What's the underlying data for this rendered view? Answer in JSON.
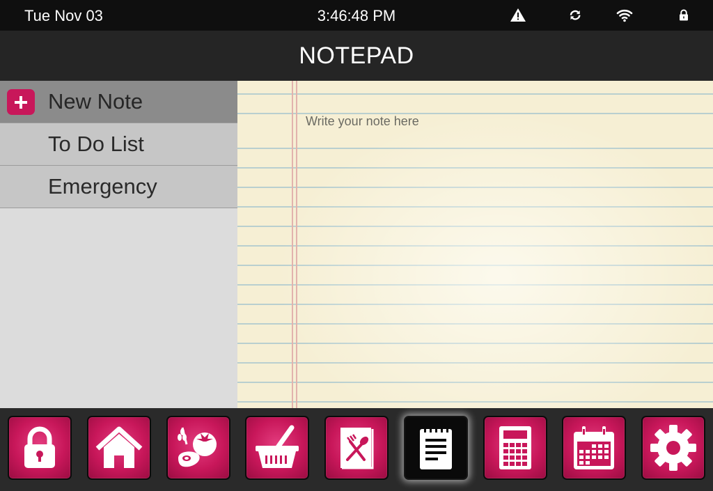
{
  "status_bar": {
    "date": "Tue Nov 03",
    "time": "3:46:48 PM",
    "icons": [
      "warning-icon",
      "sync-icon",
      "wifi-icon",
      "lock-icon"
    ]
  },
  "title": "NOTEPAD",
  "sidebar": {
    "items": [
      {
        "label": "New Note",
        "active": true,
        "icon": "plus-icon"
      },
      {
        "label": "To Do List",
        "active": false
      },
      {
        "label": "Emergency",
        "active": false
      }
    ]
  },
  "note": {
    "placeholder": "Write your note here",
    "value": ""
  },
  "dock": {
    "items": [
      {
        "icon": "lock-icon",
        "active": false
      },
      {
        "icon": "home-icon",
        "active": false
      },
      {
        "icon": "food-icon",
        "active": false
      },
      {
        "icon": "shopping-basket-icon",
        "active": false
      },
      {
        "icon": "recipe-book-icon",
        "active": false
      },
      {
        "icon": "notepad-icon",
        "active": true
      },
      {
        "icon": "calculator-icon",
        "active": false
      },
      {
        "icon": "calendar-icon",
        "active": false
      },
      {
        "icon": "settings-gear-icon",
        "active": false
      }
    ]
  },
  "colors": {
    "accent": "#c8175a",
    "paper": "#f6efd4",
    "sidebar_active": "#8b8b8b",
    "sidebar_item": "#c6c6c6",
    "title_bar": "#252525"
  }
}
